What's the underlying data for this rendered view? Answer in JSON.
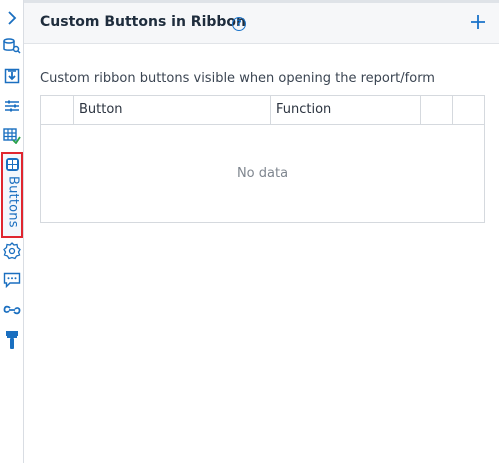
{
  "panel": {
    "title": "Custom Buttons in Ribbon",
    "help_icon": "question-circle-icon",
    "add_icon": "plus-icon",
    "description": "Custom ribbon buttons visible when opening the report/form"
  },
  "sidebar": {
    "items": [
      {
        "name": "expand",
        "icon": "chevron-right-icon"
      },
      {
        "name": "data-source",
        "icon": "database-search-icon"
      },
      {
        "name": "download",
        "icon": "download-icon"
      },
      {
        "name": "filters",
        "icon": "sliders-icon"
      },
      {
        "name": "table-check",
        "icon": "table-check-icon"
      },
      {
        "name": "buttons",
        "icon": "grid-button-icon",
        "label": "Buttons",
        "active": true
      },
      {
        "name": "settings",
        "icon": "gear-icon"
      },
      {
        "name": "comments",
        "icon": "chat-bubble-icon"
      },
      {
        "name": "links",
        "icon": "link-icon"
      },
      {
        "name": "format-painter",
        "icon": "paint-roller-icon"
      }
    ]
  },
  "table": {
    "columns": [
      "",
      "Button",
      "Function",
      "",
      ""
    ],
    "empty_text": "No data"
  },
  "colors": {
    "accent": "#1a73c9",
    "active_outline": "#e0262f"
  }
}
